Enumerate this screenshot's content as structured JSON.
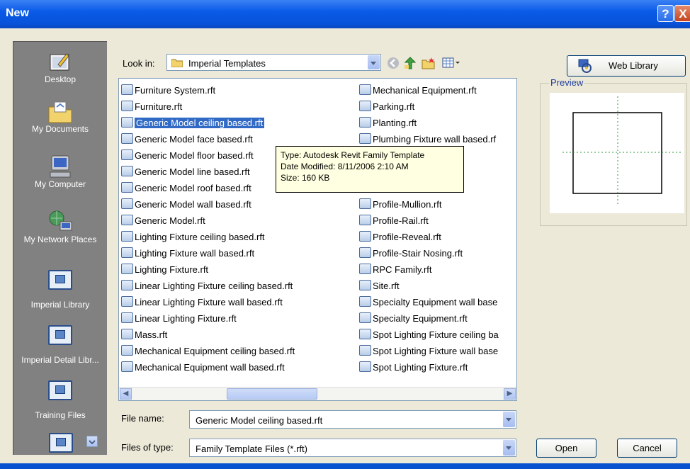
{
  "window": {
    "title": "New",
    "help_glyph": "?",
    "close_glyph": "X"
  },
  "places": [
    {
      "label": "Desktop",
      "icon": "desktop-icon"
    },
    {
      "label": "My Documents",
      "icon": "my-documents-icon"
    },
    {
      "label": "My Computer",
      "icon": "my-computer-icon"
    },
    {
      "label": "My Network Places",
      "icon": "network-places-icon"
    },
    {
      "label": "Imperial Library",
      "icon": "folder-icon"
    },
    {
      "label": "Imperial Detail Libr...",
      "icon": "folder-icon"
    },
    {
      "label": "Training Files",
      "icon": "folder-icon"
    }
  ],
  "lookin": {
    "label": "Look in:",
    "value": "Imperial Templates"
  },
  "files_col1": [
    "Furniture System.rft",
    "Furniture.rft",
    "Generic Model ceiling based.rft",
    "Generic Model face based.rft",
    "Generic Model floor based.rft",
    "Generic Model line based.rft",
    "Generic Model roof based.rft",
    "Generic Model wall based.rft",
    "Generic Model.rft",
    "Lighting Fixture ceiling based.rft",
    "Lighting Fixture wall based.rft",
    "Lighting Fixture.rft",
    "Linear Lighting Fixture ceiling based.rft",
    "Linear Lighting Fixture wall based.rft",
    "Linear Lighting Fixture.rft",
    "Mass.rft",
    "Mechanical Equipment ceiling based.rft",
    "Mechanical Equipment wall based.rft"
  ],
  "files_col2": [
    "Mechanical Equipment.rft",
    "Parking.rft",
    "Planting.rft",
    "Plumbing Fixture wall based.rf",
    "",
    "",
    "",
    "Profile-Mullion.rft",
    "Profile-Rail.rft",
    "Profile-Reveal.rft",
    "Profile-Stair Nosing.rft",
    "RPC Family.rft",
    "Site.rft",
    "Specialty Equipment wall base",
    "Specialty Equipment.rft",
    "Spot Lighting Fixture ceiling ba",
    "Spot Lighting Fixture wall base",
    "Spot Lighting Fixture.rft"
  ],
  "selected_index": 2,
  "tooltip": {
    "type": "Type: Autodesk Revit Family Template",
    "modified": "Date Modified: 8/11/2006 2:10 AM",
    "size": "Size: 160 KB"
  },
  "web_library": {
    "label": "Web Library",
    "icon": "web-library-icon"
  },
  "preview": {
    "label": "Preview"
  },
  "filename": {
    "label": "File name:",
    "value": "Generic Model ceiling based.rft"
  },
  "filetype": {
    "label": "Files of type:",
    "value": "Family Template Files (*.rft)"
  },
  "buttons": {
    "open": "Open",
    "cancel": "Cancel"
  },
  "colors": {
    "title_bar": "#0a5be8",
    "places_bg": "#818181",
    "selection": "#316ac5",
    "tooltip_bg": "#ffffe1"
  }
}
